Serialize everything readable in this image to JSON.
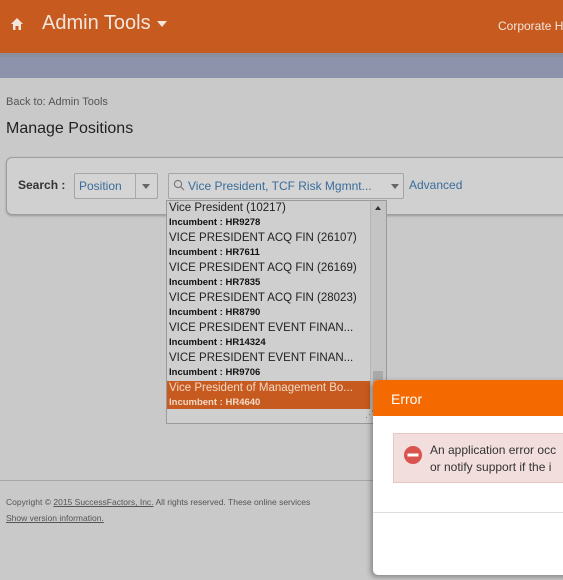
{
  "header": {
    "app_title": "Admin Tools",
    "company": "Corporate H",
    "icons": {
      "home": "home-icon",
      "menu": "caret-down-icon"
    },
    "colors": {
      "brand": "#c65a1f",
      "subbar": "#8c93ab"
    }
  },
  "breadcrumb": {
    "back_label": "Back to: Admin Tools"
  },
  "page": {
    "title": "Manage Positions"
  },
  "search": {
    "label": "Search :",
    "type_value": "Position",
    "position_value": "Vice President, TCF Risk Mgmnt...",
    "advanced_label": "Advanced"
  },
  "dropdown": {
    "items": [
      {
        "title": "Vice President (10217)",
        "subtitle": "Incumbent :  HR9278"
      },
      {
        "title": "VICE PRESIDENT ACQ FIN (26107)",
        "subtitle": "Incumbent :  HR7611"
      },
      {
        "title": "VICE PRESIDENT ACQ FIN (26169)",
        "subtitle": "Incumbent :  HR7835"
      },
      {
        "title": "VICE PRESIDENT ACQ FIN (28023)",
        "subtitle": "Incumbent :  HR8790"
      },
      {
        "title": "VICE PRESIDENT EVENT FINAN...",
        "subtitle": "Incumbent :  HR14324"
      },
      {
        "title": "VICE PRESIDENT EVENT FINAN...",
        "subtitle": "Incumbent :  HR9706"
      },
      {
        "title": "Vice President of Management Bo...",
        "subtitle": "Incumbent :  HR4640"
      }
    ],
    "selected_index": 6
  },
  "footer": {
    "copyright_prefix": "Copyright © ",
    "copyright_link": "2015 SuccessFactors, Inc.",
    "copyright_suffix": " All rights reserved. These online services",
    "show_version": "Show version information."
  },
  "error_dialog": {
    "title": "Error",
    "message_line1": "An application error occ",
    "message_line2": "or notify support if the i",
    "colors": {
      "header": "#f56a00",
      "alert_bg": "#f3dede",
      "icon": "#d9534f"
    }
  }
}
